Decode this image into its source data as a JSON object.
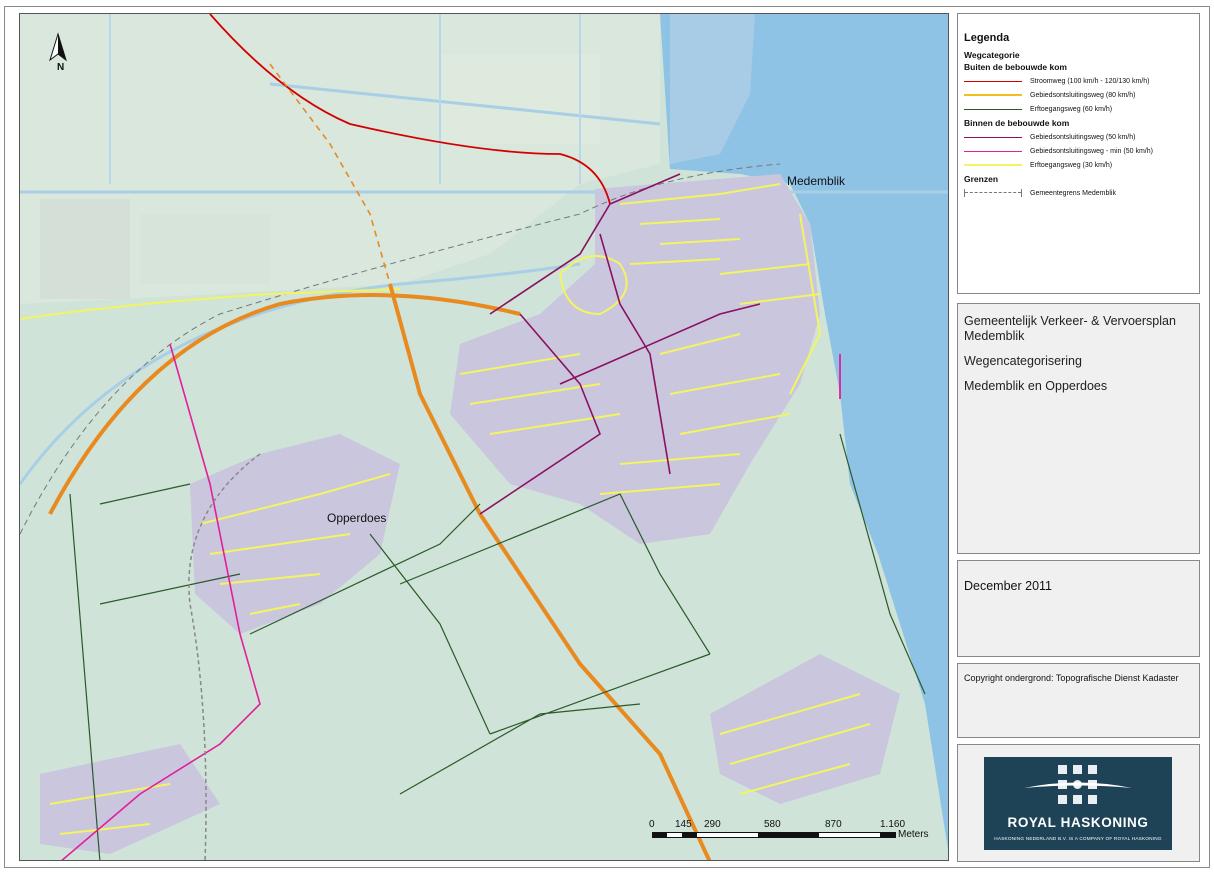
{
  "map": {
    "north_label": "N",
    "places": [
      {
        "name": "Medemblik"
      },
      {
        "name": "Opperdoes"
      }
    ],
    "scale_bar": {
      "ticks": [
        "0",
        "145",
        "290",
        "580",
        "870",
        "1.160"
      ],
      "unit": "Meters"
    }
  },
  "legend": {
    "title": "Legenda",
    "category": "Wegcategorie",
    "sections": [
      {
        "heading": "Buiten de bebouwde kom",
        "items": [
          {
            "label": "Stroomweg (100 km/h - 120/130 km/h)",
            "color": "#d40000"
          },
          {
            "label": "Gebiedsontsluitingsweg (80 km/h)",
            "color": "#f0c020"
          },
          {
            "label": "Erftoegangsweg (60 km/h)",
            "color": "#2a5a2a"
          }
        ]
      },
      {
        "heading": "Binnen de bebouwde kom",
        "items": [
          {
            "label": "Gebiedsontsluitingsweg (50 km/h)",
            "color": "#8a1060"
          },
          {
            "label": "Gebiedsontsluitingsweg - min (50 km/h)",
            "color": "#e0209a"
          },
          {
            "label": "Erftoegangsweg (30 km/h)",
            "color": "#f4f460"
          }
        ]
      }
    ],
    "borders_heading": "Grenzen",
    "border_item": "Gemeentegrens Medemblik"
  },
  "title_block": {
    "line1": "Gemeentelijk Verkeer- & Vervoersplan Medemblik",
    "line2": "Wegencategorisering",
    "line3": "Medemblik en Opperdoes"
  },
  "date": "December 2011",
  "copyright": "Copyright ondergrond: Topografische Dienst Kadaster",
  "logo": {
    "brand": "ROYAL HASKONING",
    "fine_print": "HASKONING NEDERLAND B.V. IS A COMPANY OF ROYAL HASKONING"
  },
  "colors": {
    "water": "#8ec3e6",
    "land": "#cfe3d8",
    "built_area": "#c9c6de",
    "logo_bg": "#1e4256"
  }
}
